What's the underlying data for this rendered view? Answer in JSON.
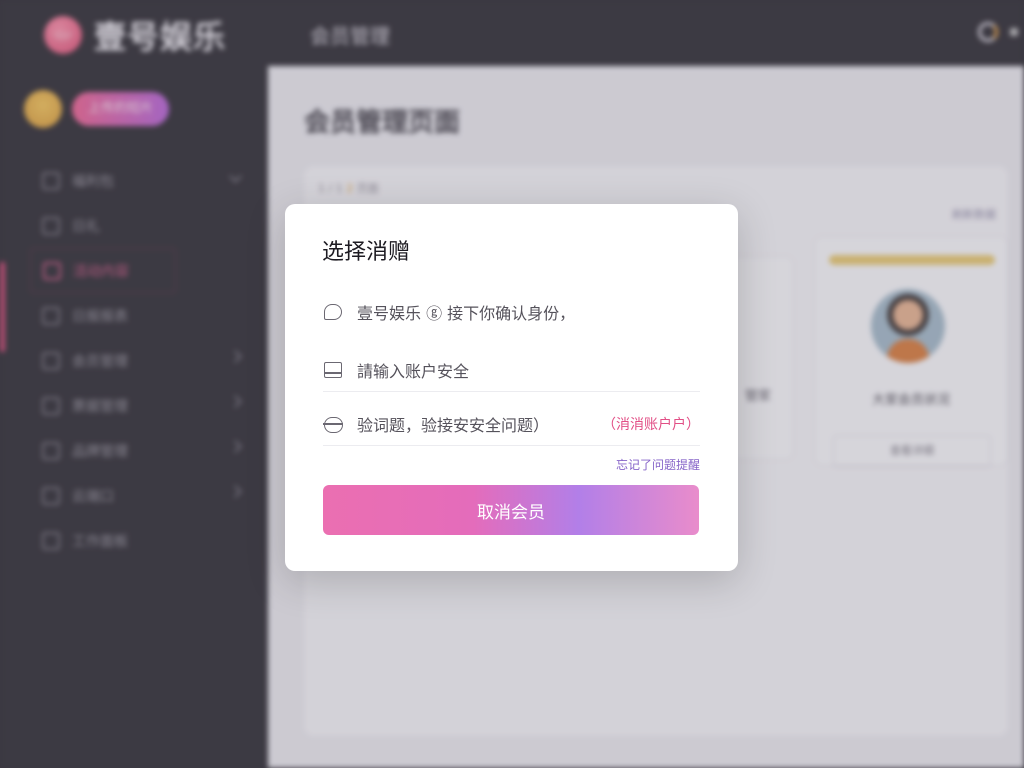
{
  "app": {
    "name": "壹号娱乐"
  },
  "sidebar": {
    "user_pill": "上传的短片",
    "items": [
      {
        "label": "福利包",
        "icon": "grid-icon",
        "expandable": true
      },
      {
        "label": "日礼",
        "icon": "gift-icon",
        "expandable": false
      },
      {
        "label": "活动内容",
        "icon": "list-icon",
        "expandable": false
      },
      {
        "label": "日报报表",
        "icon": "doc-icon",
        "expandable": false
      },
      {
        "label": "会员管理",
        "icon": "user-icon",
        "expandable": true
      },
      {
        "label": "票据管理",
        "icon": "ticket-icon",
        "expandable": true
      },
      {
        "label": "品牌管理",
        "icon": "brand-icon",
        "expandable": true
      },
      {
        "label": "云端口",
        "icon": "cloud-icon",
        "expandable": true
      },
      {
        "label": "工作面板",
        "icon": "panel-icon",
        "expandable": false
      }
    ]
  },
  "topbar": {
    "title": "会员管理"
  },
  "content": {
    "title": "会员管理页面",
    "breadcrumb": {
      "first": "1 / 1 ",
      "highlight": "2",
      "rest": " 页面"
    },
    "refresh": "刷新数据",
    "card_left_text": "管家",
    "card_right": {
      "name": "大家会员状况",
      "button": "查看详细"
    }
  },
  "modal": {
    "title": "选择消赠",
    "info_text": "壹号娱乐 ⓖ  接下你确认身份，",
    "field1_placeholder": "請输入账户安全",
    "field2_placeholder": "验词题，验接安安全问题）",
    "cancel_account_link": "（消消账户户）",
    "forgot_link": "忘记了问题提醒",
    "submit_label": "取消会员"
  },
  "colors": {
    "accent_pink": "#e24f86",
    "button_gradient": [
      "#eb6fb1",
      "#b27fe8",
      "#e98ccb"
    ],
    "sidebar_bg": "#1f1d24"
  }
}
